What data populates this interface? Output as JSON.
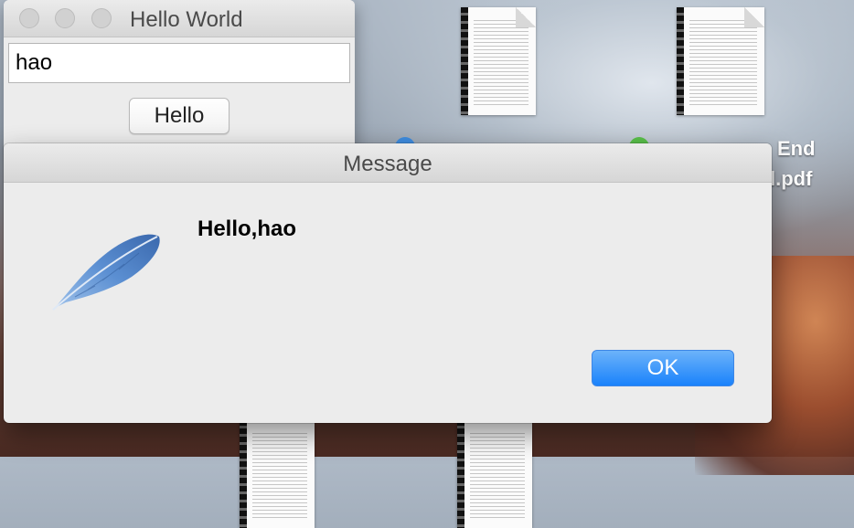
{
  "hello_window": {
    "title": "Hello World",
    "input_value": "hao",
    "hello_button_label": "Hello"
  },
  "dialog": {
    "title": "Message",
    "message": "Hello,hao",
    "ok_label": "OK",
    "icon": "feather-icon"
  },
  "desktop": {
    "label_end": "End",
    "label_pdf": "l.pdf"
  },
  "colors": {
    "ok_button": "#1a82fb",
    "feather": "#4a7fc8"
  }
}
